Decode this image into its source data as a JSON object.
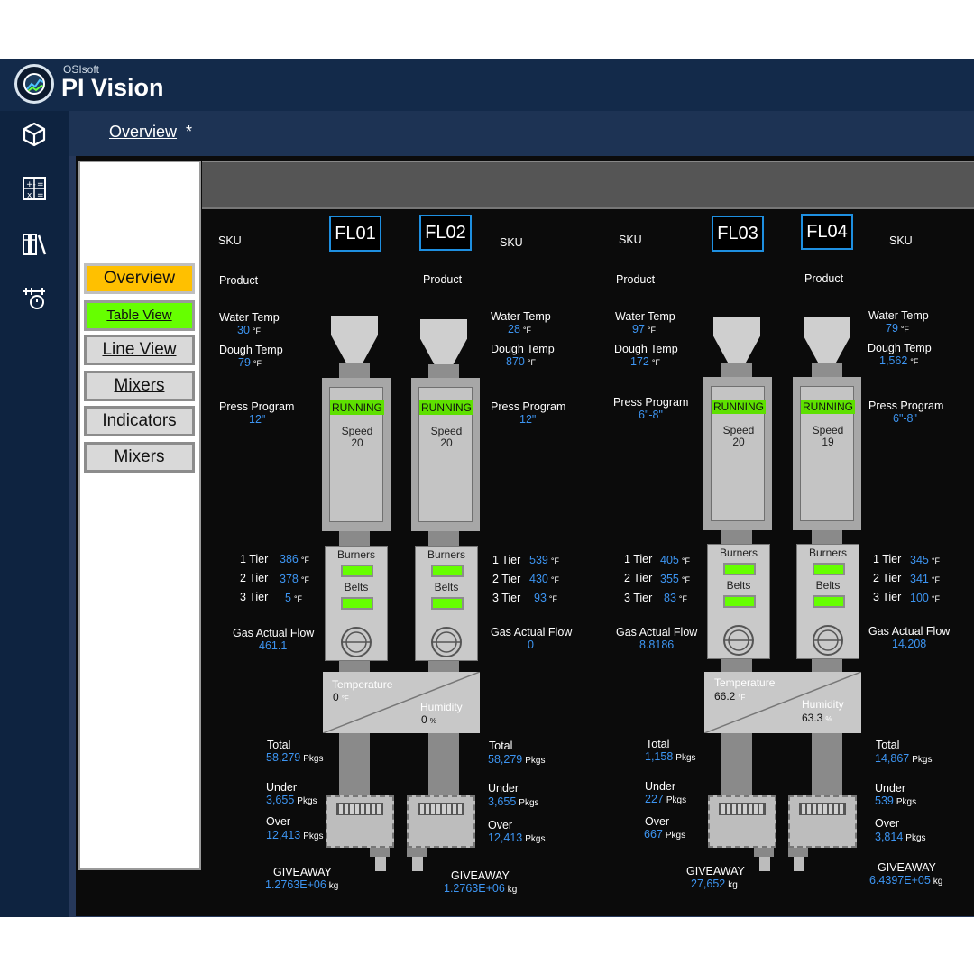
{
  "app": {
    "vendor": "OSIsoft",
    "name": "PI Vision"
  },
  "nav_icons": [
    "cube-icon",
    "calculator-icon",
    "library-icon",
    "event-frames-icon"
  ],
  "header": {
    "title": "Overview",
    "modified_marker": "*"
  },
  "menu": {
    "overview": "Overview",
    "table_view": "Table View",
    "line_view": "Line View",
    "mixers": "Mixers",
    "indicators": "Indicators",
    "mixers2": "Mixers"
  },
  "colors": {
    "running": "#5ee000",
    "value_text": "#3d95f2",
    "overview_button": "#ffc000",
    "table_view_button": "#66ff00"
  },
  "labels": {
    "sku": "SKU",
    "product": "Product",
    "water_temp": "Water Temp",
    "dough_temp": "Dough Temp",
    "press_program": "Press Program",
    "tier1": "1 Tier",
    "tier2": "2 Tier",
    "tier3": "3 Tier",
    "gas_flow": "Gas Actual Flow",
    "total": "Total",
    "under": "Under",
    "over": "Over",
    "giveaway": "GIVEAWAY",
    "burners": "Burners",
    "belts": "Belts",
    "speed": "Speed",
    "temperature": "Temperature",
    "humidity": "Humidity",
    "unit_f": "°F",
    "unit_pct": "%",
    "unit_pkgs": "Pkgs",
    "unit_kg": "kg"
  },
  "lines": [
    {
      "id": "FL01",
      "status": "RUNNING",
      "speed": "20",
      "water_temp": "30",
      "dough_temp": "79",
      "press_program": "12\"",
      "tiers": [
        "386",
        "378",
        "5"
      ],
      "gas_flow": "461.1",
      "temperature": "0",
      "humidity": "0",
      "total": "58,279",
      "under": "3,655",
      "over": "12,413",
      "giveaway": "1.2763E+06"
    },
    {
      "id": "FL02",
      "status": "RUNNING",
      "speed": "20",
      "water_temp": "28",
      "dough_temp": "870",
      "press_program": "12\"",
      "tiers": [
        "539",
        "430",
        "93"
      ],
      "gas_flow": "0",
      "total": "58,279",
      "under": "3,655",
      "over": "12,413",
      "giveaway": "1.2763E+06"
    },
    {
      "id": "FL03",
      "status": "RUNNING",
      "speed": "20",
      "water_temp": "97",
      "dough_temp": "172",
      "press_program": "6\"-8\"",
      "tiers": [
        "405",
        "355",
        "83"
      ],
      "gas_flow": "8.8186",
      "temperature": "66.2",
      "humidity": "63.3",
      "total": "1,158",
      "under": "227",
      "over": "667",
      "giveaway": "27,652"
    },
    {
      "id": "FL04",
      "status": "RUNNING",
      "speed": "19",
      "water_temp": "79",
      "dough_temp": "1,562",
      "press_program": "6\"-8\"",
      "tiers": [
        "345",
        "341",
        "100"
      ],
      "gas_flow": "14.208",
      "total": "14,867",
      "under": "539",
      "over": "3,814",
      "giveaway": "6.4397E+05"
    }
  ]
}
